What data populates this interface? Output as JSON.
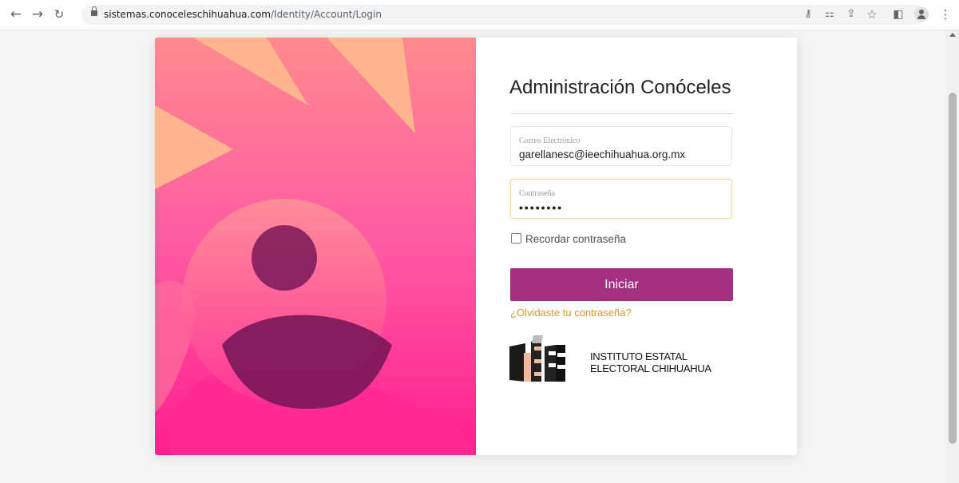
{
  "browser": {
    "url_domain": "sistemas.conoceleschihuahua.com",
    "url_path": "/Identity/Account/Login",
    "toolbar_icons": [
      "back-icon",
      "forward-icon",
      "reload-icon",
      "lock-icon",
      "key-icon",
      "translate-icon",
      "share-icon",
      "star-icon",
      "sidepanel-icon",
      "profile-icon",
      "menu-icon"
    ]
  },
  "login": {
    "title": "Administración Conóceles",
    "email": {
      "label": "Correo Electrónico",
      "value": "garellanesc@ieechihuahua.org.mx"
    },
    "password": {
      "label": "Contraseña",
      "value": "••••••••"
    },
    "remember_label": "Recordar contraseña",
    "remember_checked": false,
    "submit_label": "Iniciar",
    "forgot_label": "¿Olvidaste tu contraseña?"
  },
  "logo": {
    "text_line1": "INSTITUTO ESTATAL",
    "text_line2": "ELECTORAL CHIHUAHUA"
  },
  "colors": {
    "primary": "#a3317f",
    "link": "#d39a2f",
    "art_pink": "#ff2e93",
    "art_peach": "#ffb58e",
    "avatar_purple": "#7a1758"
  }
}
